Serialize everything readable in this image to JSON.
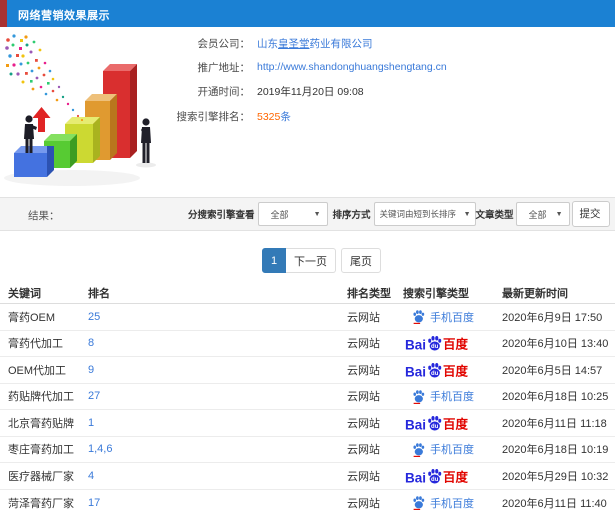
{
  "header": {
    "title": "网络营销效果展示"
  },
  "info": {
    "company_label": "会员公司：",
    "company_prefix": "山东",
    "company_mid": "皇圣堂",
    "company_suffix": "药业有限公司",
    "url_label": "推广地址：",
    "url": "http://www.shandonghuangshengtang.cn",
    "opened_label": "开通时间：",
    "opened": "2019年11月20日 09:08",
    "rankcount_label": "搜索引擎排名：",
    "rankcount": "5325",
    "rankcount_unit": "条"
  },
  "filter": {
    "result_label": "结果：",
    "engine_label": "分搜索引擎查看",
    "engine_value": "全部",
    "sort_label": "排序方式",
    "sort_value": "关键词由短到长排序",
    "article_label": "文章类型",
    "article_value": "全部",
    "submit_label": "提交"
  },
  "pagination": {
    "current": "1",
    "next": "下一页",
    "last": "尾页"
  },
  "table": {
    "columns": [
      "关键词",
      "排名",
      "排名类型",
      "搜索引擎类型",
      "最新更新时间"
    ],
    "baidu_wordmark": "Bai",
    "rows": [
      {
        "keyword": "膏药OEM",
        "rank": "25",
        "rank_type": "云网站",
        "engine": "mobile-baidu",
        "engine_label": "手机百度",
        "updated": "2020年6月9日 17:50"
      },
      {
        "keyword": "膏药代加工",
        "rank": "8",
        "rank_type": "云网站",
        "engine": "baidu",
        "engine_label": "百度",
        "updated": "2020年6月10日 13:40"
      },
      {
        "keyword": "OEM代加工",
        "rank": "9",
        "rank_type": "云网站",
        "engine": "baidu",
        "engine_label": "百度",
        "updated": "2020年6月5日 14:57"
      },
      {
        "keyword": "药贴牌代加工",
        "rank": "27",
        "rank_type": "云网站",
        "engine": "mobile-baidu",
        "engine_label": "手机百度",
        "updated": "2020年6月18日 10:25"
      },
      {
        "keyword": "北京膏药贴牌",
        "rank": "1",
        "rank_type": "云网站",
        "engine": "baidu",
        "engine_label": "百度",
        "updated": "2020年6月11日 11:18"
      },
      {
        "keyword": "枣庄膏药加工",
        "rank": "1,4,6",
        "rank_type": "云网站",
        "engine": "mobile-baidu",
        "engine_label": "手机百度",
        "updated": "2020年6月18日 10:19"
      },
      {
        "keyword": "医疗器械厂家",
        "rank": "4",
        "rank_type": "云网站",
        "engine": "baidu",
        "engine_label": "百度",
        "updated": "2020年5月29日 10:32"
      },
      {
        "keyword": "菏泽膏药厂家",
        "rank": "17",
        "rank_type": "云网站",
        "engine": "mobile-baidu",
        "engine_label": "手机百度",
        "updated": "2020年6月11日 11:40"
      }
    ]
  }
}
